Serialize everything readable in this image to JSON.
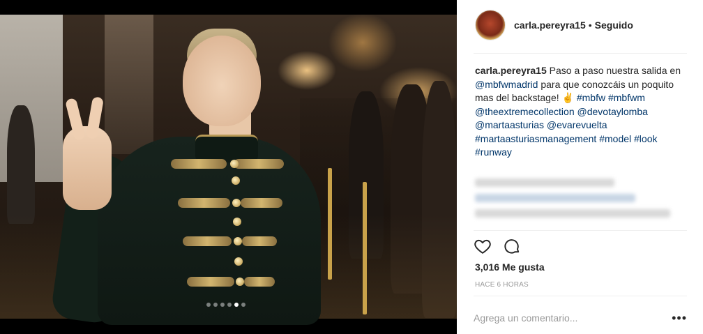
{
  "post": {
    "username": "carla.pereyra15",
    "separator": "•",
    "follow_status": "Seguido",
    "caption": {
      "author": "carla.pereyra15",
      "text_1": "Paso a paso nuestra salida en",
      "mention_1": "@mbfwmadrid",
      "text_2": "para que conozcáis un poquito mas del backstage! ✌",
      "hashtag_1": "#mbfw",
      "hashtag_2": "#mbfwm",
      "mention_2": "@theextremecollection",
      "mention_3": "@devotaylomba",
      "mention_4": "@martaasturias",
      "mention_5": "@evarevuelta",
      "hashtag_3": "#martaasturiasmanagement",
      "hashtag_4": "#model",
      "hashtag_5": "#look",
      "hashtag_6": "#runway"
    },
    "likes": "3,016 Me gusta",
    "time": "HACE 6 HORAS",
    "comment_placeholder": "Agrega un comentario...",
    "more_label": "•••",
    "carousel": {
      "count": 6,
      "active_index": 4
    }
  },
  "icons": {
    "like": "heart-icon",
    "comment": "comment-bubble-icon",
    "more": "more-options-icon"
  },
  "colors": {
    "text": "#262626",
    "link": "#003569",
    "muted": "#999999",
    "divider": "#efefef"
  }
}
